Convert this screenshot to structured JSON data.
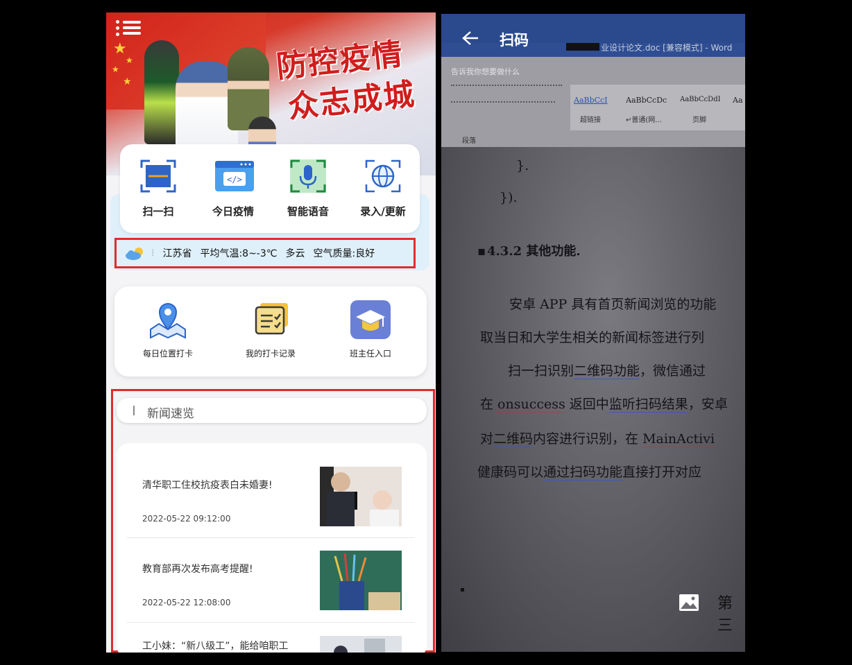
{
  "left_app": {
    "banner": {
      "slogan_line1": "防控疫情",
      "slogan_line2": "众志成城"
    },
    "quick_actions": [
      {
        "label": "扫一扫"
      },
      {
        "label": "今日疫情"
      },
      {
        "label": "智能语音"
      },
      {
        "label": "录入/更新"
      }
    ],
    "weather": {
      "province": "江苏省",
      "temperature": "平均气温:8~-3℃",
      "condition": "多云",
      "air_quality": "空气质量:良好"
    },
    "services": [
      {
        "label": "每日位置打卡"
      },
      {
        "label": "我的打卡记录"
      },
      {
        "label": "班主任入口"
      }
    ],
    "news": {
      "header": "新闻速览",
      "items": [
        {
          "title": "清华职工住校抗疫表白未婚妻!",
          "date": "2022-05-22 09:12:00"
        },
        {
          "title": "教育部再次发布高考提醒!",
          "date": "2022-05-22 12:08:00"
        },
        {
          "title": "工小妹：“新八级工”，能给咱职工",
          "date": ""
        }
      ]
    }
  },
  "right_app": {
    "header": {
      "title": "扫码"
    },
    "camera_view": {
      "word_window_title": "业设计论文.doc [兼容模式] - Word",
      "tell_me": "告诉我你想要做什么",
      "styles": [
        {
          "sample": "AaBbCcI",
          "name": "超链接"
        },
        {
          "sample": "AaBbCcDc",
          "name": "↵普通(网..."
        },
        {
          "sample": "AaBbCcDdI",
          "name": "页脚"
        },
        {
          "sample": "Aa",
          "name": ""
        }
      ],
      "paragraph_group": "段落",
      "doc_lines": {
        "code1": "}.",
        "code2": "}).",
        "heading": "4.3.2  其他功能.",
        "p1": "安卓 APP 具有首页新闻浏览的功能",
        "p2": "取当日和大学生相关的新闻标签进行列",
        "p3_a": "扫一扫识别",
        "p3_b": "二维码功能",
        "p3_c": "，微信通过",
        "p4_a": "在 ",
        "p4_b": "onsuccess",
        "p4_c": " 返回中",
        "p4_d": "监听扫码结果",
        "p4_e": "，安卓",
        "p5_a": "对",
        "p5_b": "二维码",
        "p5_c": "内容进行识别，在 ",
        "p5_d": "MainActivi",
        "p6_a": "健康码可以",
        "p6_b": "通过扫码功能",
        "p6_c": "直接打开对应",
        "footer": "第三"
      }
    }
  },
  "colors": {
    "highlight_border": "#e02b2b",
    "word_blue": "#2b4a8e",
    "slogan_red": "#d01d1d"
  }
}
